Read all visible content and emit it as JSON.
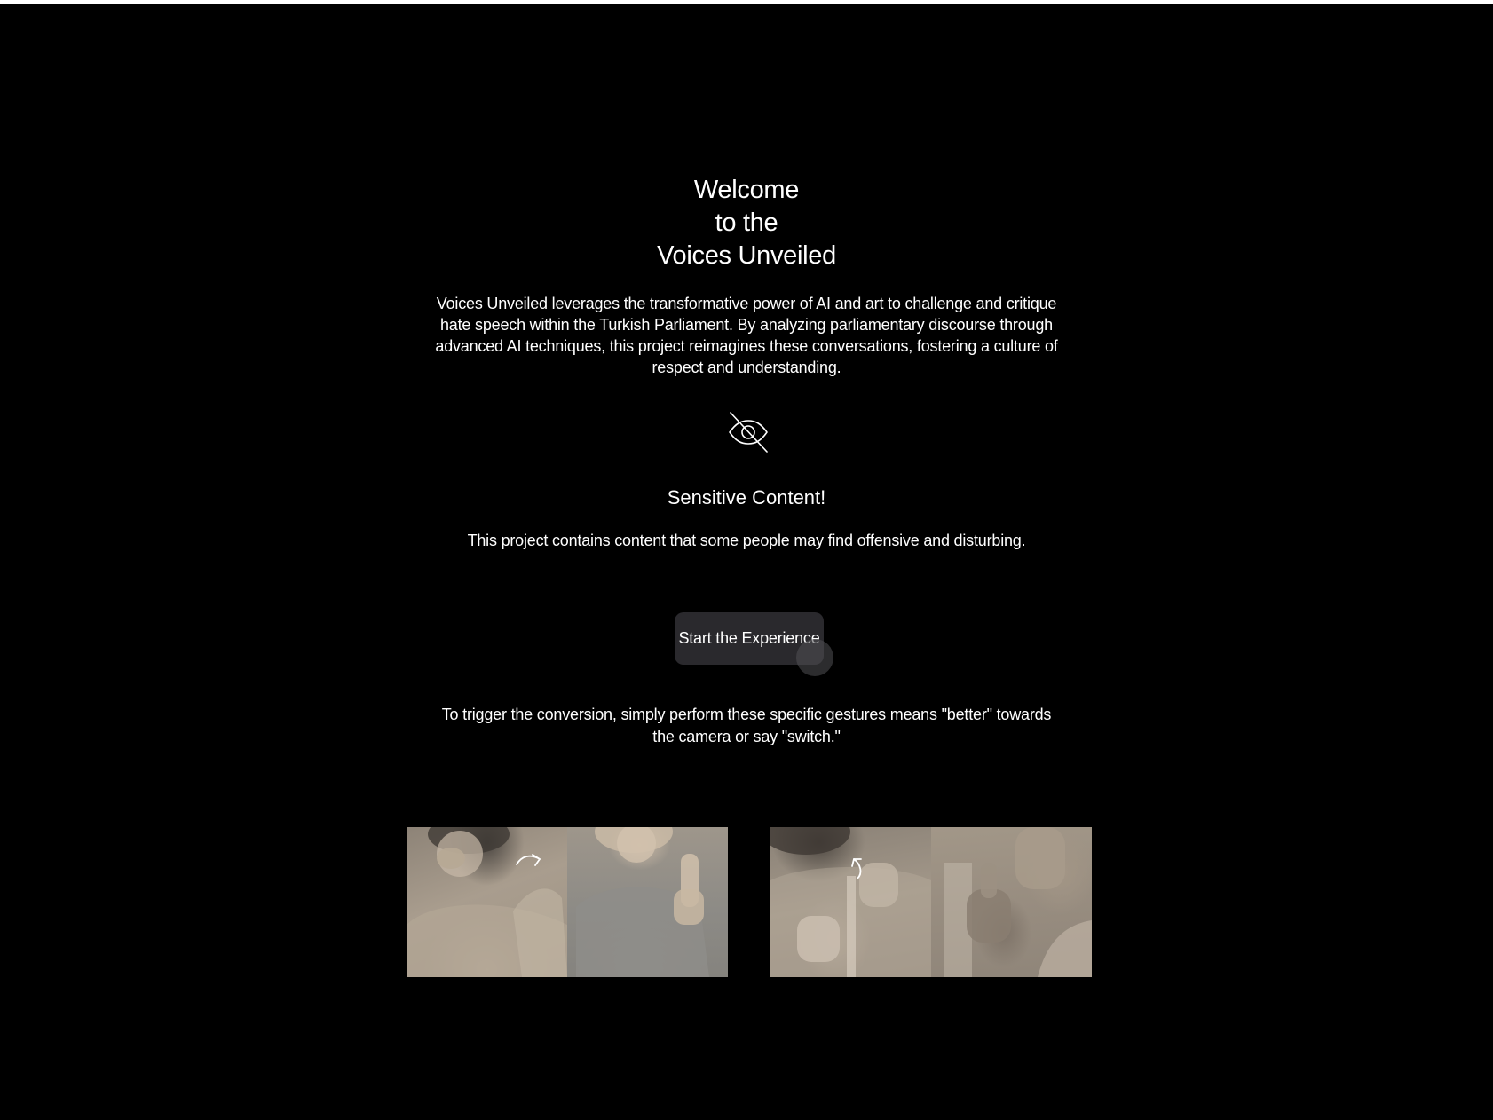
{
  "welcome": {
    "title_lines": [
      "Welcome",
      "to the",
      "Voices Unveiled"
    ],
    "description": "Voices Unveiled leverages the transformative power of AI and art to challenge and critique hate speech within the Turkish Parliament. By analyzing parliamentary discourse through advanced AI techniques, this project reimagines these conversations, fostering a culture of respect and understanding."
  },
  "warning": {
    "icon": "eye-off-icon",
    "title": "Sensitive Content!",
    "text": "This project contains content that some people may find offensive and disturbing."
  },
  "start_button": {
    "label": "Start the Experience"
  },
  "instructions": {
    "text": "To trigger the conversion, simply perform these specific gestures means \"better\" towards the camera or say \"switch.\""
  },
  "gestures": [
    {
      "name": "gesture-better-1",
      "arrow_icon": "curved-arrow-icon"
    },
    {
      "name": "gesture-better-2",
      "arrow_icon": "curved-arrow-icon"
    }
  ],
  "colors": {
    "background": "#000000",
    "text": "#ffffff",
    "button_background": "#2a292d"
  }
}
